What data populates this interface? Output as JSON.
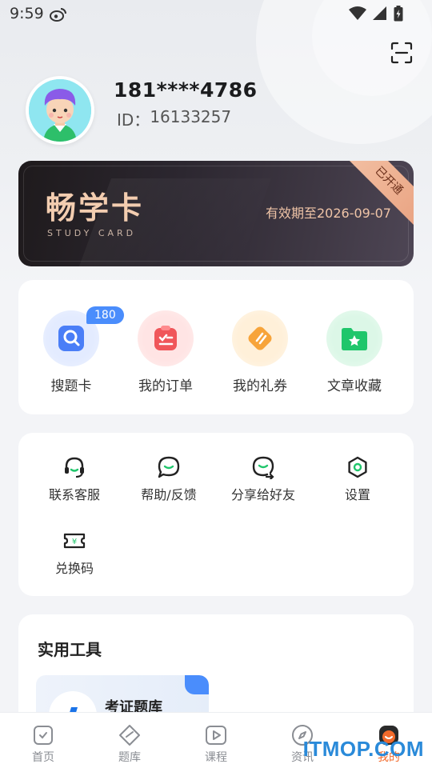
{
  "status_bar": {
    "time": "9:59"
  },
  "profile": {
    "phone": "181****4786",
    "id_label": "ID：",
    "id_value": "16133257"
  },
  "vip_card": {
    "title": "畅学卡",
    "subtitle": "STUDY CARD",
    "expire": "有效期至2026-09-07",
    "ribbon": "已开通"
  },
  "quick_actions": [
    {
      "label": "搜题卡",
      "badge": "180",
      "icon": "search-card-icon",
      "color": "#4a7ef7"
    },
    {
      "label": "我的订单",
      "icon": "order-icon",
      "color": "#f0565a"
    },
    {
      "label": "我的礼券",
      "icon": "coupon-icon",
      "color": "#f7a43a"
    },
    {
      "label": "文章收藏",
      "icon": "favorite-folder-icon",
      "color": "#1fc66b"
    }
  ],
  "services": [
    {
      "label": "联系客服",
      "icon": "headset-icon"
    },
    {
      "label": "帮助/反馈",
      "icon": "chat-bubble-icon"
    },
    {
      "label": "分享给好友",
      "icon": "share-icon"
    },
    {
      "label": "设置",
      "icon": "settings-icon"
    },
    {
      "label": "兑换码",
      "icon": "ticket-icon"
    }
  ],
  "tools": {
    "title": "实用工具",
    "items": [
      {
        "label": "考证题库",
        "icon": "question-bank-icon"
      }
    ]
  },
  "tabbar": [
    {
      "label": "首页",
      "icon": "home-icon"
    },
    {
      "label": "题库",
      "icon": "question-bank-tab-icon"
    },
    {
      "label": "课程",
      "icon": "course-play-icon"
    },
    {
      "label": "资讯",
      "icon": "compass-icon"
    },
    {
      "label": "我的",
      "icon": "profile-tab-icon",
      "active": true
    }
  ],
  "watermark": "ITMOP.COM",
  "colors": {
    "accent": "#f26a2b",
    "badge": "#4a8dfc",
    "vip_gold": "#f3cdb0"
  }
}
